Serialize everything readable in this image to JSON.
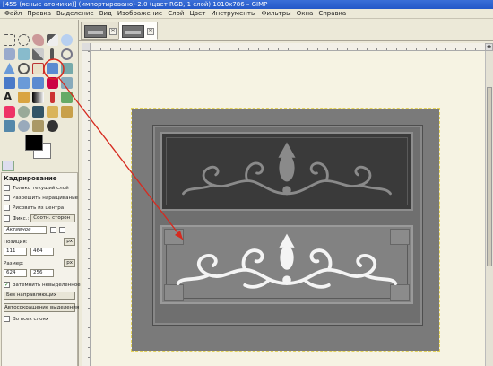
{
  "window": {
    "title": "[455 (ясные атомики)] (импортировано)-2.0 (цвет RGB, 1 слой) 1010x786 – GIMP"
  },
  "menu": [
    "Файл",
    "Правка",
    "Выделение",
    "Вид",
    "Изображение",
    "Слой",
    "Цвет",
    "Инструменты",
    "Фильтры",
    "Окна",
    "Справка"
  ],
  "image_tabs": [
    {
      "thumbnail": "image-thumbnail",
      "close": "✕",
      "active": false
    },
    {
      "thumbnail": "image-thumbnail",
      "close": "✕",
      "active": true
    }
  ],
  "toolbox": {
    "fg_color": "#000000",
    "bg_color": "#ffffff",
    "highlight_color": "#d62a1f"
  },
  "tool_options": {
    "title": "Кадрирование",
    "current_layer_only": "Только текущий слой",
    "allow_growing": "Разрешить наращивание",
    "expand_from_center": "Рисовать из центра",
    "fixed_label": "Фикс.:",
    "fixed_value": "Соотн. сторон",
    "aspect_field": "Активное",
    "position_label": "Позиция:",
    "position_unit": "px",
    "position_x": "111",
    "position_y": "464",
    "size_label": "Размер:",
    "size_unit": "px",
    "size_w": "624",
    "size_h": "256",
    "highlight": "Затемнить невыделенное",
    "highlight_checked": true,
    "guides": "Без направляющих",
    "autoshrink": "Автосокращение выделения",
    "all_layers": "Во всех слоях"
  }
}
